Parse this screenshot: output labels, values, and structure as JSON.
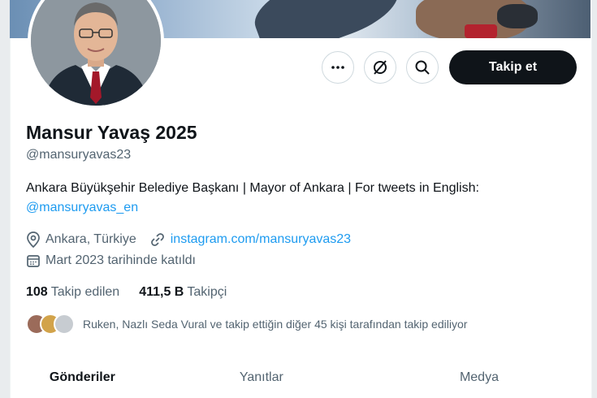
{
  "profile": {
    "name": "Mansur Yavaş 2025",
    "handle": "@mansuryavas23",
    "bio_text": "Ankara Büyükşehir Belediye Başkanı | Mayor of Ankara | For tweets in English:",
    "bio_link": "@mansuryavas_en",
    "location": "Ankara, Türkiye",
    "website": "instagram.com/mansuryavas23",
    "joined": "Mart 2023 tarihinde katıldı"
  },
  "stats": {
    "following_count": "108",
    "following_label": "Takip edilen",
    "followers_count": "411,5 B",
    "followers_label": "Takipçi"
  },
  "followed_by_text": "Ruken, Nazlı Seda Vural ve takip ettiğin diğer 45 kişi tarafından takip ediliyor",
  "actions": {
    "follow_label": "Takip et",
    "more_icon": "more-icon",
    "grok-icon": "grok-icon",
    "search_icon": "search-icon"
  },
  "tabs": [
    {
      "label": "Gönderiler"
    },
    {
      "label": "Yanıtlar"
    },
    {
      "label": "Medya"
    }
  ],
  "colors": {
    "accent": "#1d9bf0",
    "follow_bg": "#0f1419",
    "secondary_text": "#536471"
  }
}
